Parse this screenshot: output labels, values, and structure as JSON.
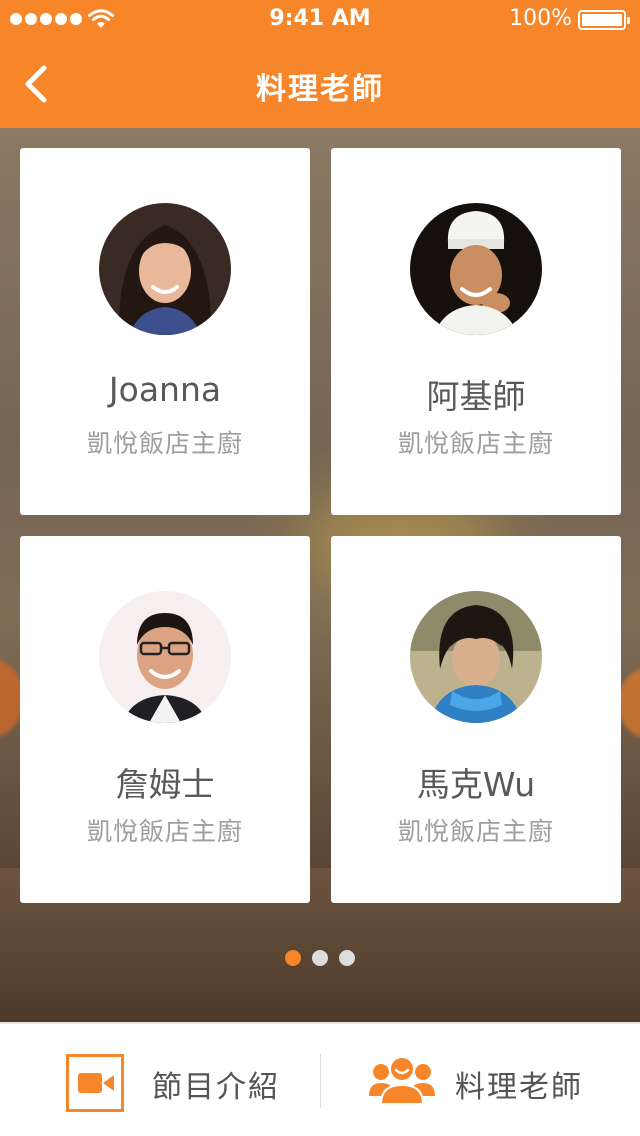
{
  "status_bar": {
    "time": "9:41 AM",
    "battery": "100%"
  },
  "nav": {
    "title": "料理老師",
    "back_icon": "chevron-left-icon"
  },
  "theme": {
    "accent": "#f7862a",
    "card_bg": "#ffffff",
    "name_color": "#595959",
    "title_color": "#9e9e9e"
  },
  "chefs": [
    {
      "name": "Joanna",
      "title": "凱悅飯店主廚",
      "avatar_icon": "chef-avatar-joanna"
    },
    {
      "name": "阿基師",
      "title": "凱悅飯店主廚",
      "avatar_icon": "chef-avatar-akishi"
    },
    {
      "name": "詹姆士",
      "title": "凱悅飯店主廚",
      "avatar_icon": "chef-avatar-james"
    },
    {
      "name": "馬克Wu",
      "title": "凱悅飯店主廚",
      "avatar_icon": "chef-avatar-markwu"
    }
  ],
  "pager": {
    "pages": 3,
    "current": 1
  },
  "tabbar": {
    "tabs": [
      {
        "label": "節目介紹",
        "icon": "video-camera-icon",
        "active": false
      },
      {
        "label": "料理老師",
        "icon": "people-icon",
        "active": true
      }
    ]
  }
}
